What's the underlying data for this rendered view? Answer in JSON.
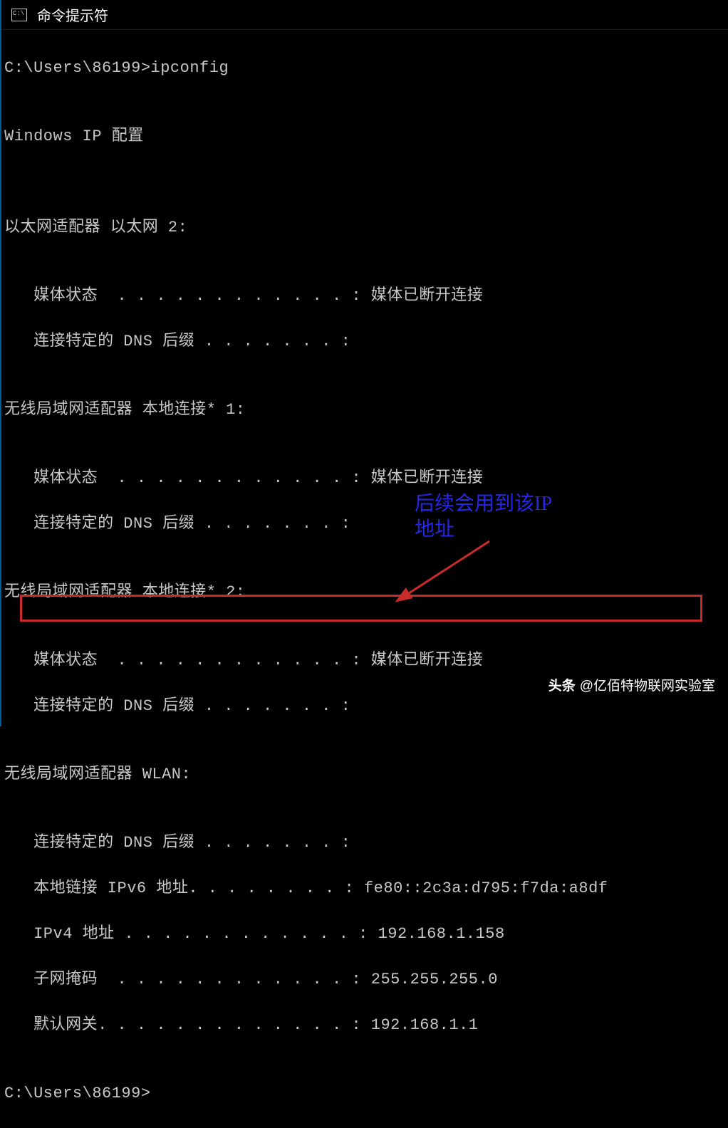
{
  "titlebar": {
    "icon_text": "C:\\",
    "title": "命令提示符"
  },
  "terminal": {
    "prompt1": "C:\\Users\\86199>ipconfig",
    "blank": "",
    "header": "Windows IP 配置",
    "adapter1": {
      "title": "以太网适配器 以太网 2:",
      "media": "   媒体状态  . . . . . . . . . . . . : 媒体已断开连接",
      "dns_suffix": "   连接特定的 DNS 后缀 . . . . . . . :"
    },
    "adapter2": {
      "title": "无线局域网适配器 本地连接* 1:",
      "media": "   媒体状态  . . . . . . . . . . . . : 媒体已断开连接",
      "dns_suffix": "   连接特定的 DNS 后缀 . . . . . . . :"
    },
    "adapter3": {
      "title": "无线局域网适配器 本地连接* 2:",
      "media": "   媒体状态  . . . . . . . . . . . . : 媒体已断开连接",
      "dns_suffix": "   连接特定的 DNS 后缀 . . . . . . . :"
    },
    "adapter4": {
      "title": "无线局域网适配器 WLAN:",
      "dns_suffix": "   连接特定的 DNS 后缀 . . . . . . . :",
      "ipv6": "   本地链接 IPv6 地址. . . . . . . . : fe80::2c3a:d795:f7da:a8df",
      "ipv4": "   IPv4 地址 . . . . . . . . . . . . : 192.168.1.158",
      "subnet": "   子网掩码  . . . . . . . . . . . . : 255.255.255.0",
      "gateway": "   默认网关. . . . . . . . . . . . . : 192.168.1.1"
    },
    "prompt2": "C:\\Users\\86199>"
  },
  "annotation": {
    "text_line1": "后续会用到该IP",
    "text_line2": "地址"
  },
  "watermark": {
    "brand": "头条",
    "author": "@亿佰特物联网实验室"
  }
}
